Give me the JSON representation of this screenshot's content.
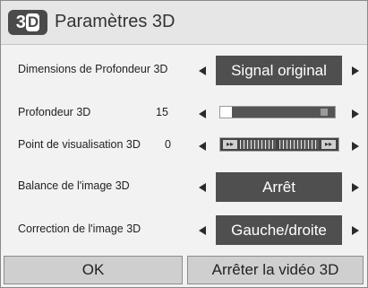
{
  "dialog": {
    "title": "Paramètres 3D",
    "icon": "3d-icon",
    "icon_letters": "3",
    "icon_letter_d": "D"
  },
  "rows": [
    {
      "label": "Dimensions de Profondeur 3D",
      "value": "Signal original"
    },
    {
      "label": "Profondeur 3D",
      "number": "15",
      "slider_fraction": 0.1
    },
    {
      "label": "Point de visualisation 3D",
      "number": "0"
    },
    {
      "label": "Balance de l'image 3D",
      "value": "Arrêt"
    },
    {
      "label": "Correction de l'image 3D",
      "value": "Gauche/droite"
    }
  ],
  "buttons": {
    "ok": "OK",
    "stop": "Arrêter la vidéo 3D"
  },
  "colors": {
    "value_bg": "#4f4f4f",
    "title_bg": "#e6e6e6",
    "button_bg": "#cfcfcf"
  }
}
